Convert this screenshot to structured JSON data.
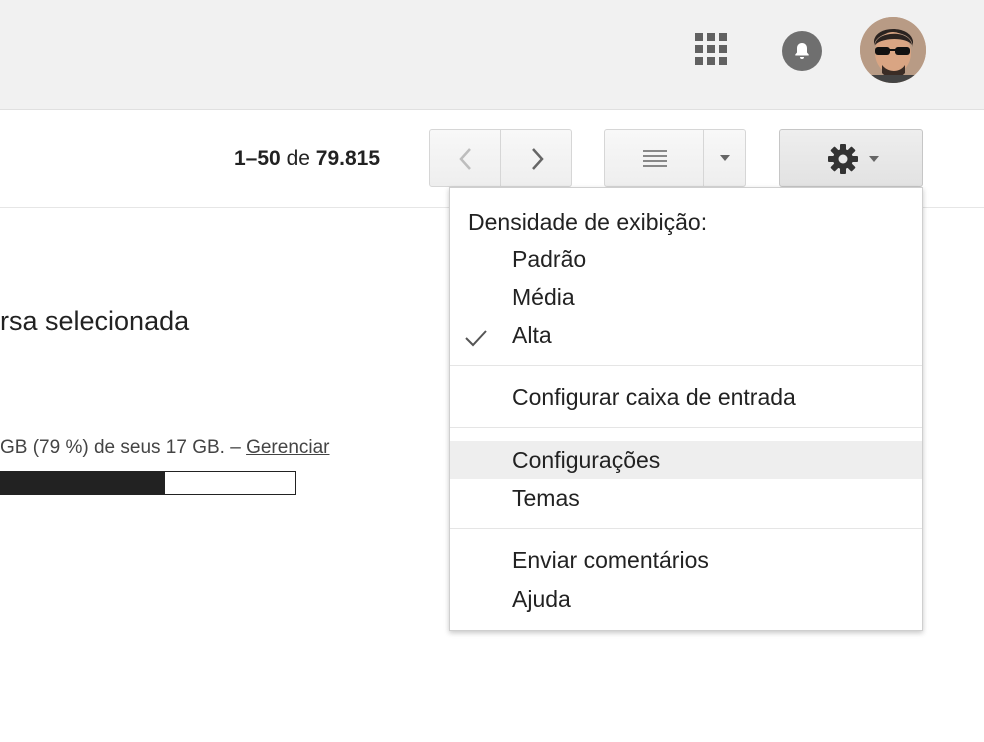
{
  "header": {
    "apps_icon": "apps-grid-icon",
    "notifications_icon": "notifications-bell-icon",
    "avatar": "user-avatar"
  },
  "toolbar": {
    "range": "1–50",
    "of": "de",
    "total": "79.815",
    "prev_icon": "chevron-left-icon",
    "next_icon": "chevron-right-icon",
    "density_icon": "density-lines-icon",
    "settings_icon": "gear-icon"
  },
  "main": {
    "conversation_text": "rsa selecionada",
    "storage_text": "GB (79 %) de seus 17 GB. – ",
    "manage_label": "Gerenciar",
    "storage_used_fraction": 0.79
  },
  "settings_menu": {
    "density_heading": "Densidade de exibição:",
    "density_options": [
      {
        "label": "Padrão",
        "selected": false
      },
      {
        "label": "Média",
        "selected": false
      },
      {
        "label": "Alta",
        "selected": true
      }
    ],
    "configure_inbox": "Configurar caixa de entrada",
    "settings": "Configurações",
    "themes": "Temas",
    "send_feedback": "Enviar comentários",
    "help": "Ajuda",
    "highlighted_item": "Configurações"
  },
  "colors": {
    "header_bg": "#f1f1f1",
    "menu_hover": "#eeeeee",
    "text": "#222222"
  }
}
